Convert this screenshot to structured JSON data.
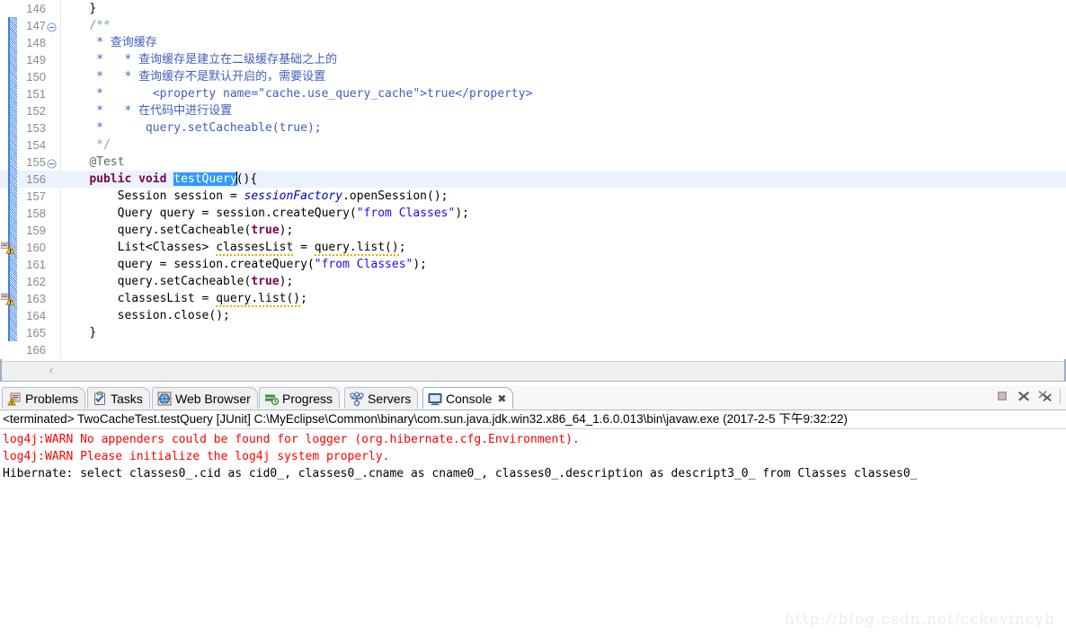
{
  "editor": {
    "first_line": 146,
    "current_line": 156,
    "lines": [
      {
        "n": "146",
        "fold": false,
        "change": false,
        "warn": false,
        "indent": 4,
        "tokens": [
          {
            "t": "}",
            "c": "plain"
          }
        ]
      },
      {
        "n": "147",
        "fold": true,
        "change": true,
        "warn": false,
        "indent": 4,
        "tokens": [
          {
            "t": "/**",
            "c": "cmttag"
          }
        ]
      },
      {
        "n": "148",
        "fold": false,
        "change": true,
        "warn": false,
        "indent": 5,
        "tokens": [
          {
            "t": "* 查询缓存",
            "c": "cmt"
          }
        ]
      },
      {
        "n": "149",
        "fold": false,
        "change": true,
        "warn": false,
        "indent": 5,
        "tokens": [
          {
            "t": "*   * 查询缓存是建立在二级缓存基础之上的",
            "c": "cmt"
          }
        ]
      },
      {
        "n": "150",
        "fold": false,
        "change": true,
        "warn": false,
        "indent": 5,
        "tokens": [
          {
            "t": "*   * 查询缓存不是默认开启的，需要设置",
            "c": "cmt"
          }
        ]
      },
      {
        "n": "151",
        "fold": false,
        "change": true,
        "warn": false,
        "indent": 5,
        "tokens": [
          {
            "t": "*       <property name=\"cache.use_query_cache\">true</property>",
            "c": "cmt"
          }
        ]
      },
      {
        "n": "152",
        "fold": false,
        "change": true,
        "warn": false,
        "indent": 5,
        "tokens": [
          {
            "t": "*   * 在代码中进行设置",
            "c": "cmt"
          }
        ]
      },
      {
        "n": "153",
        "fold": false,
        "change": true,
        "warn": false,
        "indent": 5,
        "tokens": [
          {
            "t": "*      query.setCacheable(true);",
            "c": "cmt"
          }
        ]
      },
      {
        "n": "154",
        "fold": false,
        "change": true,
        "warn": false,
        "indent": 5,
        "tokens": [
          {
            "t": "*/",
            "c": "cmttag"
          }
        ]
      },
      {
        "n": "155",
        "fold": true,
        "change": true,
        "warn": false,
        "indent": 4,
        "tokens": [
          {
            "t": "@Test",
            "c": "ann"
          }
        ]
      },
      {
        "n": "156",
        "fold": false,
        "change": true,
        "warn": false,
        "indent": 4,
        "tokens": [
          {
            "t": "public",
            "c": "kw"
          },
          {
            "t": " ",
            "c": "plain"
          },
          {
            "t": "void",
            "c": "kw"
          },
          {
            "t": " ",
            "c": "plain"
          },
          {
            "t": "testQuery",
            "c": "sel"
          },
          {
            "t": "",
            "c": "caret"
          },
          {
            "t": "(){",
            "c": "plain"
          }
        ]
      },
      {
        "n": "157",
        "fold": false,
        "change": true,
        "warn": false,
        "indent": 8,
        "tokens": [
          {
            "t": "Session session = ",
            "c": "plain"
          },
          {
            "t": "sessionFactory",
            "c": "field"
          },
          {
            "t": ".openSession();",
            "c": "plain"
          }
        ]
      },
      {
        "n": "158",
        "fold": false,
        "change": true,
        "warn": false,
        "indent": 8,
        "tokens": [
          {
            "t": "Query query = session.createQuery(",
            "c": "plain"
          },
          {
            "t": "\"from Classes\"",
            "c": "str"
          },
          {
            "t": ");",
            "c": "plain"
          }
        ]
      },
      {
        "n": "159",
        "fold": false,
        "change": true,
        "warn": false,
        "indent": 8,
        "tokens": [
          {
            "t": "query.setCacheable(",
            "c": "plain"
          },
          {
            "t": "true",
            "c": "kw"
          },
          {
            "t": ");",
            "c": "plain"
          }
        ]
      },
      {
        "n": "160",
        "fold": false,
        "change": true,
        "warn": true,
        "indent": 8,
        "tokens": [
          {
            "t": "List<Classes> ",
            "c": "plain"
          },
          {
            "t": "classesList",
            "c": "squig"
          },
          {
            "t": " = ",
            "c": "plain"
          },
          {
            "t": "query.list()",
            "c": "squig"
          },
          {
            "t": ";",
            "c": "plain"
          }
        ]
      },
      {
        "n": "161",
        "fold": false,
        "change": true,
        "warn": false,
        "indent": 8,
        "tokens": [
          {
            "t": "query = session.createQuery(",
            "c": "plain"
          },
          {
            "t": "\"from Classes\"",
            "c": "str"
          },
          {
            "t": ");",
            "c": "plain"
          }
        ]
      },
      {
        "n": "162",
        "fold": false,
        "change": true,
        "warn": false,
        "indent": 8,
        "tokens": [
          {
            "t": "query.setCacheable(",
            "c": "plain"
          },
          {
            "t": "true",
            "c": "kw"
          },
          {
            "t": ");",
            "c": "plain"
          }
        ]
      },
      {
        "n": "163",
        "fold": false,
        "change": true,
        "warn": true,
        "indent": 8,
        "tokens": [
          {
            "t": "classesList = ",
            "c": "plain"
          },
          {
            "t": "query.list()",
            "c": "squig"
          },
          {
            "t": ";",
            "c": "plain"
          }
        ]
      },
      {
        "n": "164",
        "fold": false,
        "change": true,
        "warn": false,
        "indent": 8,
        "tokens": [
          {
            "t": "session.close();",
            "c": "plain"
          }
        ]
      },
      {
        "n": "165",
        "fold": false,
        "change": true,
        "warn": false,
        "indent": 4,
        "tokens": [
          {
            "t": "}",
            "c": "plain"
          }
        ]
      },
      {
        "n": "166",
        "fold": false,
        "change": false,
        "warn": false,
        "indent": 0,
        "tokens": [
          {
            "t": "",
            "c": "plain"
          }
        ]
      }
    ],
    "hscroll_left_arrow": "‹"
  },
  "bottom_view": {
    "tabs": [
      {
        "label": "Problems",
        "icon": "problems-icon",
        "active": false,
        "closable": false
      },
      {
        "label": "Tasks",
        "icon": "tasks-icon",
        "active": false,
        "closable": false
      },
      {
        "label": "Web Browser",
        "icon": "web-browser-icon",
        "active": false,
        "closable": false
      },
      {
        "label": "Progress",
        "icon": "progress-icon",
        "active": false,
        "closable": false
      },
      {
        "label": "Servers",
        "icon": "servers-icon",
        "active": false,
        "closable": false
      },
      {
        "label": "Console",
        "icon": "console-icon",
        "active": true,
        "closable": true
      }
    ],
    "close_glyph": "✖",
    "toolbar": [
      {
        "name": "terminate-button",
        "title": "Terminate"
      },
      {
        "name": "remove-button",
        "title": "Remove Launch"
      },
      {
        "name": "remove-all-button",
        "title": "Remove All Terminated Launches"
      }
    ],
    "console": {
      "header": "<terminated> TwoCacheTest.testQuery [JUnit] C:\\MyEclipse\\Common\\binary\\com.sun.java.jdk.win32.x86_64_1.6.0.013\\bin\\javaw.exe (2017-2-5 下午9:32:22)",
      "lines": [
        {
          "text": "log4j:WARN No appenders could be found for logger (org.hibernate.cfg.Environment).",
          "color": "red"
        },
        {
          "text": "log4j:WARN Please initialize the log4j system properly.",
          "color": "red"
        },
        {
          "text": "Hibernate: select classes0_.cid as cid0_, classes0_.cname as cname0_, classes0_.description as descript3_0_ from Classes classes0_",
          "color": "black"
        }
      ]
    }
  },
  "watermark": "http://blog.csdn.net/cckevincyh",
  "colors": {
    "keyword": "#7f0055",
    "string": "#2a00ff",
    "comment": "#3f5fbf",
    "field": "#0000c0",
    "selection": "#3399ff",
    "current_line": "#eaf2fd",
    "console_error": "#ff0000",
    "change_bar": "#4a86e8"
  }
}
